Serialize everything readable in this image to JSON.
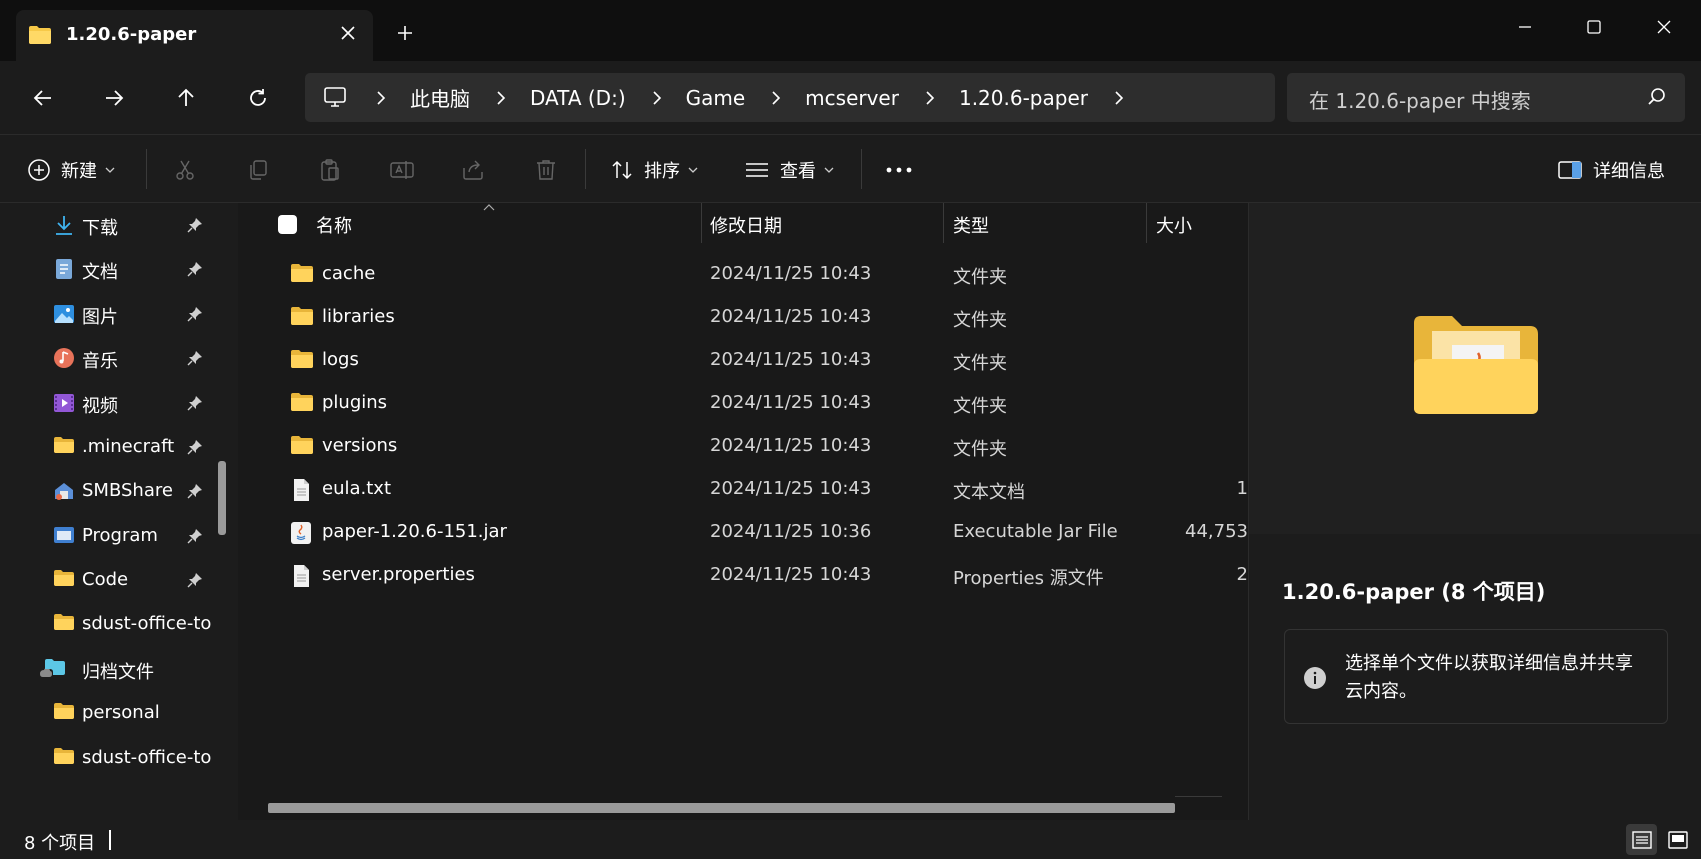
{
  "window": {
    "tab_title": "1.20.6-paper"
  },
  "address": {
    "crumbs": [
      "此电脑",
      "DATA (D:)",
      "Game",
      "mcserver",
      "1.20.6-paper"
    ],
    "search_placeholder": "在 1.20.6-paper 中搜索"
  },
  "toolbar": {
    "new_label": "新建",
    "sort_label": "排序",
    "view_label": "查看",
    "details_label": "详细信息"
  },
  "sidebar": {
    "items": [
      {
        "label": "下载",
        "icon": "download-icon",
        "pinned": true
      },
      {
        "label": "文档",
        "icon": "documents-icon",
        "pinned": true
      },
      {
        "label": "图片",
        "icon": "pictures-icon",
        "pinned": true
      },
      {
        "label": "音乐",
        "icon": "music-icon",
        "pinned": true
      },
      {
        "label": "视频",
        "icon": "videos-icon",
        "pinned": true
      },
      {
        "label": ".minecraft",
        "icon": "folder-icon",
        "pinned": true
      },
      {
        "label": "SMBShare",
        "icon": "network-folder-icon",
        "pinned": true
      },
      {
        "label": "Program",
        "icon": "program-folder-icon",
        "pinned": true
      },
      {
        "label": "Code",
        "icon": "folder-icon",
        "pinned": true
      },
      {
        "label": "sdust-office-to",
        "icon": "folder-icon",
        "pinned": false
      },
      {
        "label": "归档文件",
        "icon": "cloud-folder-icon",
        "pinned": false
      },
      {
        "label": "personal",
        "icon": "folder-icon",
        "pinned": false
      },
      {
        "label": "sdust-office-to",
        "icon": "folder-icon",
        "pinned": false
      }
    ]
  },
  "columns": {
    "name": "名称",
    "modified": "修改日期",
    "type": "类型",
    "size": "大小"
  },
  "files": [
    {
      "name": "cache",
      "modified": "2024/11/25 10:43",
      "type": "文件夹",
      "size": "",
      "icon": "folder-icon"
    },
    {
      "name": "libraries",
      "modified": "2024/11/25 10:43",
      "type": "文件夹",
      "size": "",
      "icon": "folder-icon"
    },
    {
      "name": "logs",
      "modified": "2024/11/25 10:43",
      "type": "文件夹",
      "size": "",
      "icon": "folder-icon"
    },
    {
      "name": "plugins",
      "modified": "2024/11/25 10:43",
      "type": "文件夹",
      "size": "",
      "icon": "folder-icon"
    },
    {
      "name": "versions",
      "modified": "2024/11/25 10:43",
      "type": "文件夹",
      "size": "",
      "icon": "folder-icon"
    },
    {
      "name": "eula.txt",
      "modified": "2024/11/25 10:43",
      "type": "文本文档",
      "size": "1",
      "icon": "text-file-icon"
    },
    {
      "name": "paper-1.20.6-151.jar",
      "modified": "2024/11/25 10:36",
      "type": "Executable Jar File",
      "size": "44,753",
      "icon": "java-jar-icon"
    },
    {
      "name": "server.properties",
      "modified": "2024/11/25 10:43",
      "type": "Properties 源文件",
      "size": "2",
      "icon": "text-file-icon"
    }
  ],
  "details": {
    "title": "1.20.6-paper (8 个项目)",
    "message": "选择单个文件以获取详细信息并共享云内容。"
  },
  "status": {
    "item_count": "8 个项目"
  },
  "colors": {
    "folder": "#f7c948",
    "background": "#191919",
    "panel": "#1c1c1c",
    "input": "#2d2d2d"
  }
}
